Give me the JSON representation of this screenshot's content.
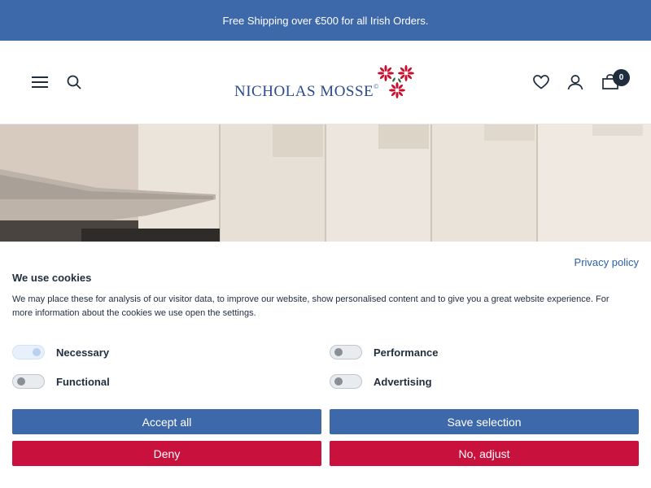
{
  "announcement": {
    "text": "Free Shipping over €500 for all Irish Orders."
  },
  "header": {
    "logo_text": "NICHOLAS MOSSE",
    "logo_mark": "©",
    "cart_count": "0",
    "icons": [
      "hamburger-menu-icon",
      "search-icon",
      "heart-icon",
      "account-icon",
      "cart-icon"
    ]
  },
  "cookie_banner": {
    "privacy_link": "Privacy policy",
    "title": "We use cookies",
    "description": "We may place these for analysis of our visitor data, to improve our website, show personalised content and to give you a great website experience. For more information about the cookies we use open the settings.",
    "options": [
      {
        "label": "Necessary",
        "state": "on"
      },
      {
        "label": "Performance",
        "state": "off"
      },
      {
        "label": "Functional",
        "state": "off"
      },
      {
        "label": "Advertising",
        "state": "off"
      }
    ],
    "buttons": {
      "accept_all": "Accept all",
      "save_selection": "Save selection",
      "deny": "Deny",
      "no_adjust": "No, adjust"
    }
  },
  "colors": {
    "brand_blue": "#3d69ab",
    "deny_red": "#c8123d",
    "logo_blue": "#2c4b8c",
    "logo_red": "#c8102e"
  }
}
